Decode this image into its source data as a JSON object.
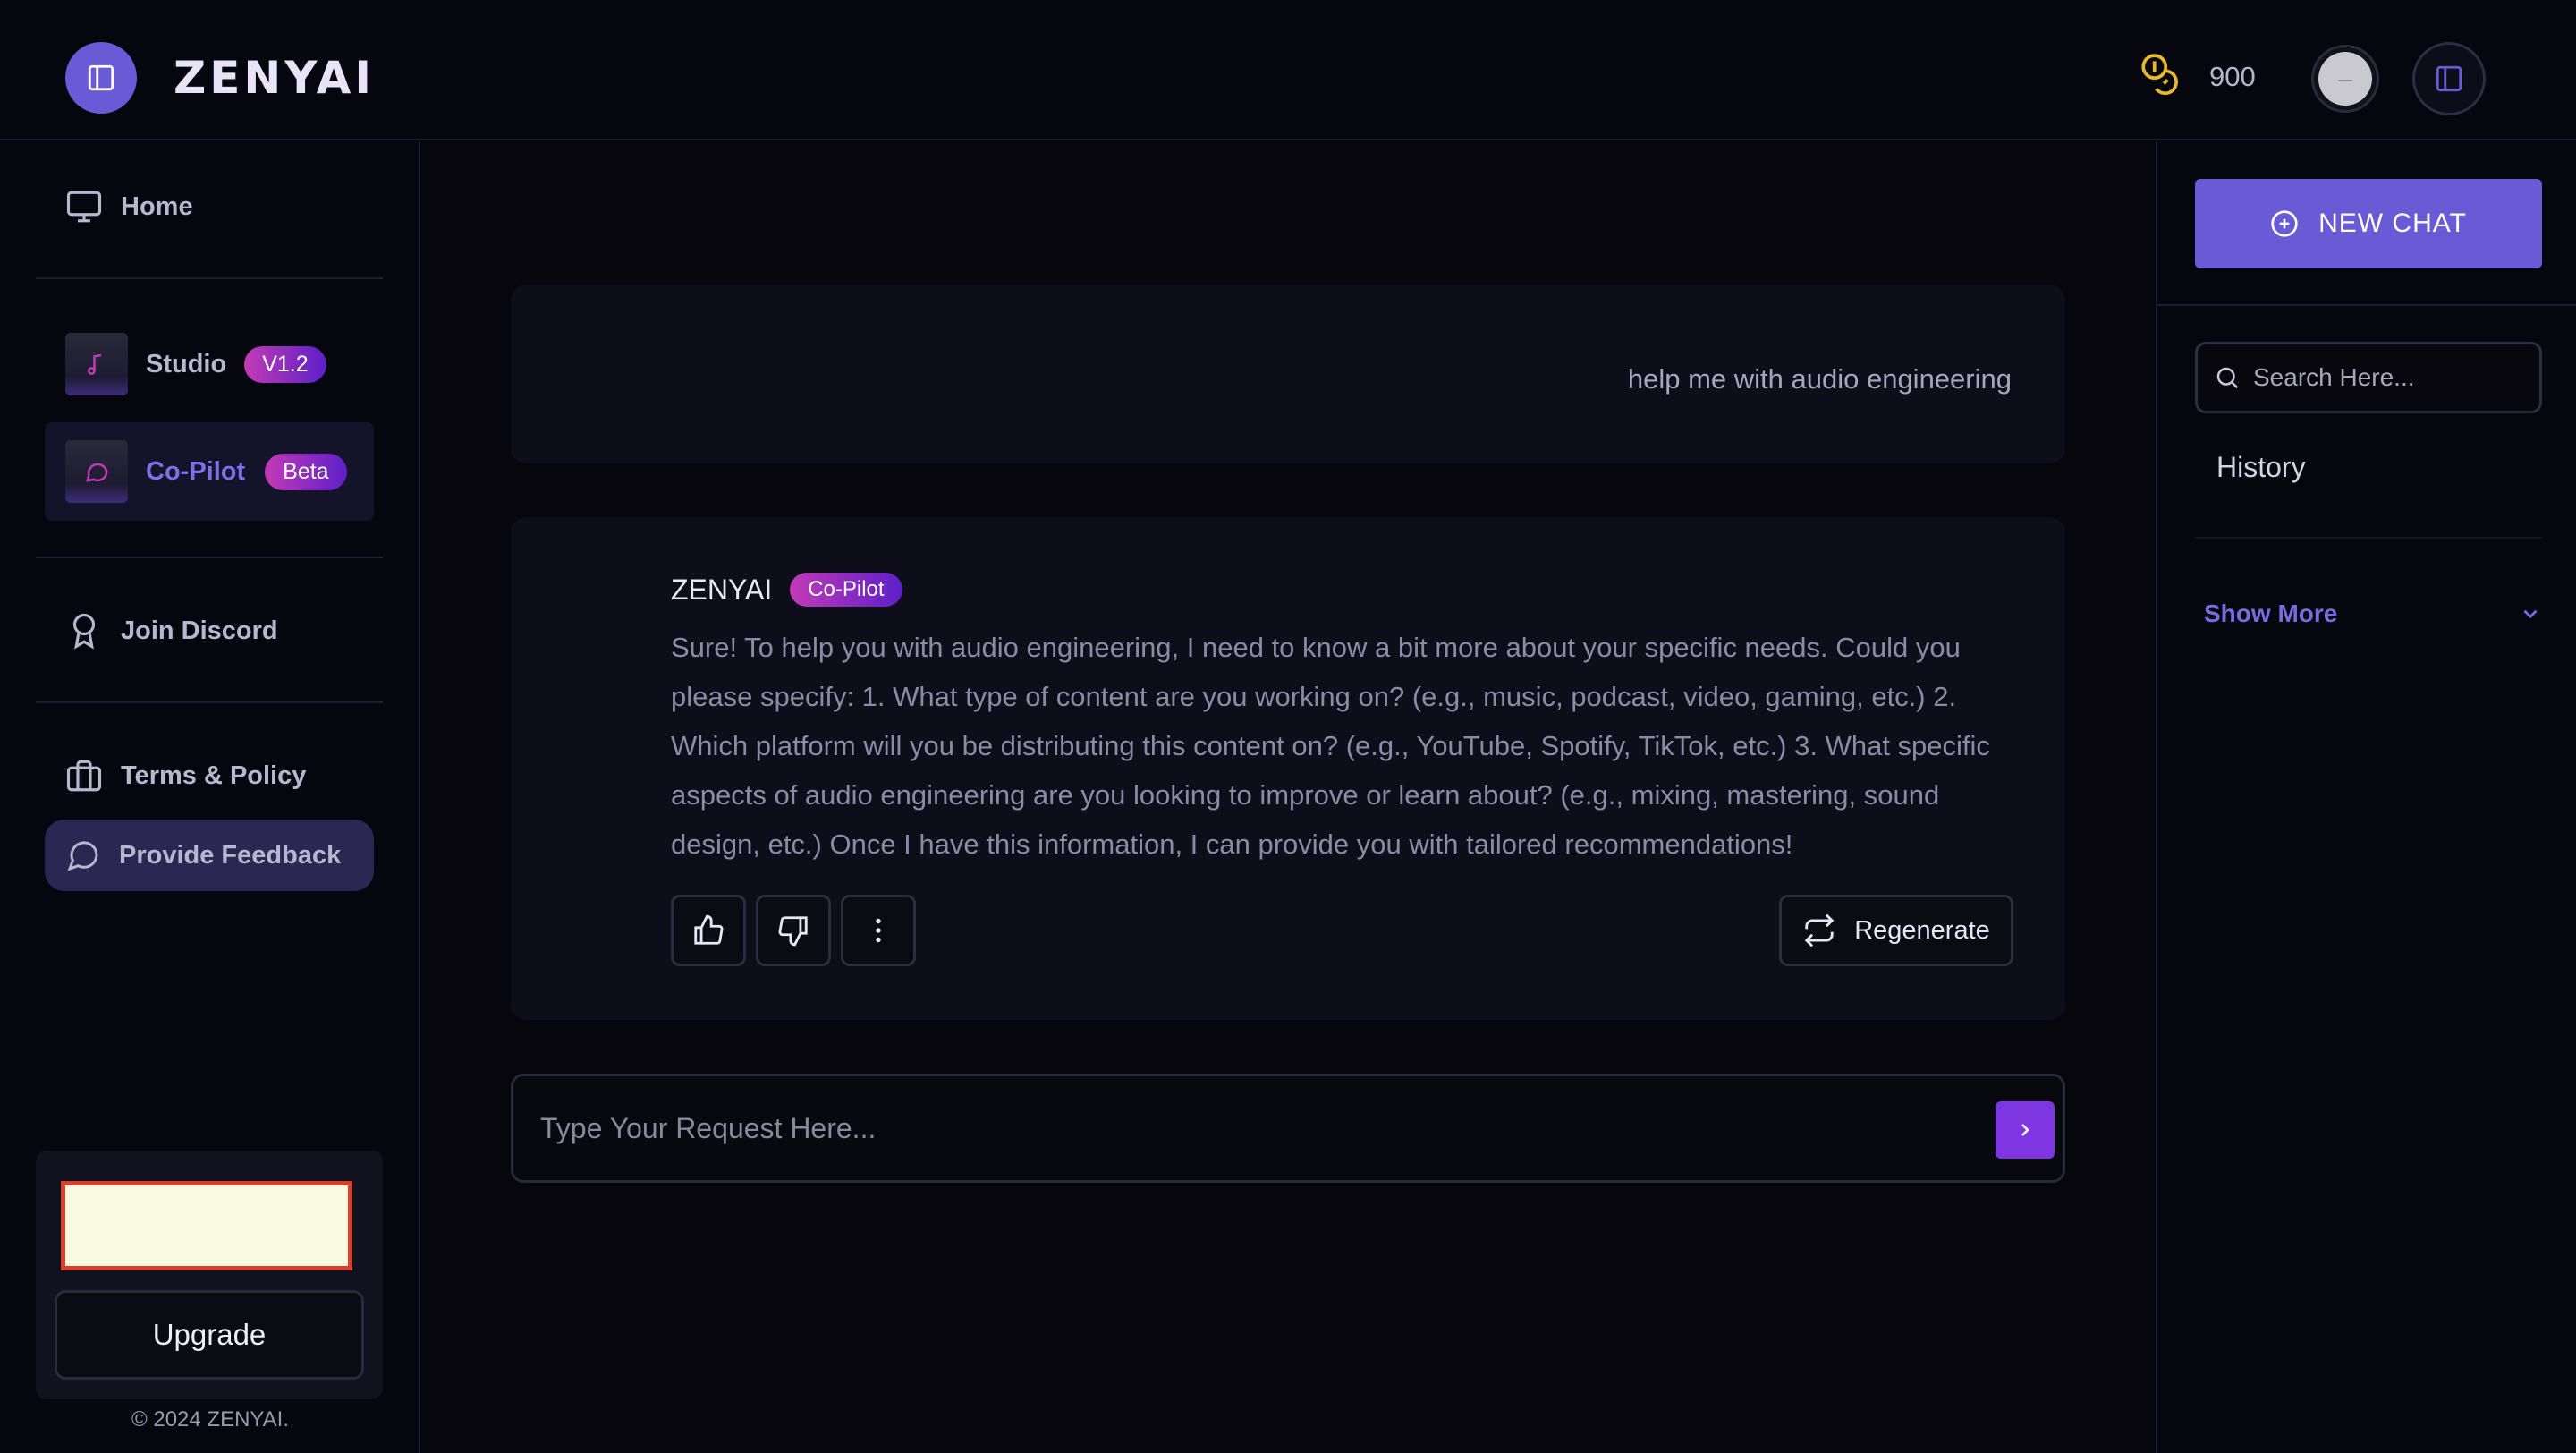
{
  "header": {
    "brand": "ZENYAI",
    "credits": "900",
    "avatar_glyph": "–"
  },
  "sidebar": {
    "home_label": "Home",
    "studio_label": "Studio",
    "studio_badge": "V1.2",
    "copilot_label": "Co-Pilot",
    "copilot_badge": "Beta",
    "discord_label": "Join Discord",
    "terms_label": "Terms & Policy",
    "feedback_label": "Provide Feedback",
    "upgrade_label": "Upgrade",
    "copyright": "© 2024 ZENYAI."
  },
  "chat": {
    "user_message": "help me with audio engineering",
    "bot_name": "ZENYAI",
    "bot_badge": "Co-Pilot",
    "bot_message": "Sure! To help you with audio engineering, I need to know a bit more about your specific needs. Could you please specify: 1. What type of content are you working on? (e.g., music, podcast, video, gaming, etc.) 2. Which platform will you be distributing this content on? (e.g., YouTube, Spotify, TikTok, etc.) 3. What specific aspects of audio engineering are you looking to improve or learn about? (e.g., mixing, mastering, sound design, etc.) Once I have this information, I can provide you with tailored recommendations!",
    "regenerate_label": "Regenerate",
    "input_placeholder": "Type Your Request Here..."
  },
  "right_panel": {
    "new_chat_label": "NEW CHAT",
    "search_placeholder": "Search Here...",
    "history_label": "History",
    "show_more_label": "Show More"
  },
  "colors": {
    "accent": "#6b5ad6",
    "badge_gradient_start": "#c13bb5",
    "badge_gradient_end": "#5d1fc9",
    "coin": "#e8b92c",
    "send_button": "#7d36e0"
  }
}
